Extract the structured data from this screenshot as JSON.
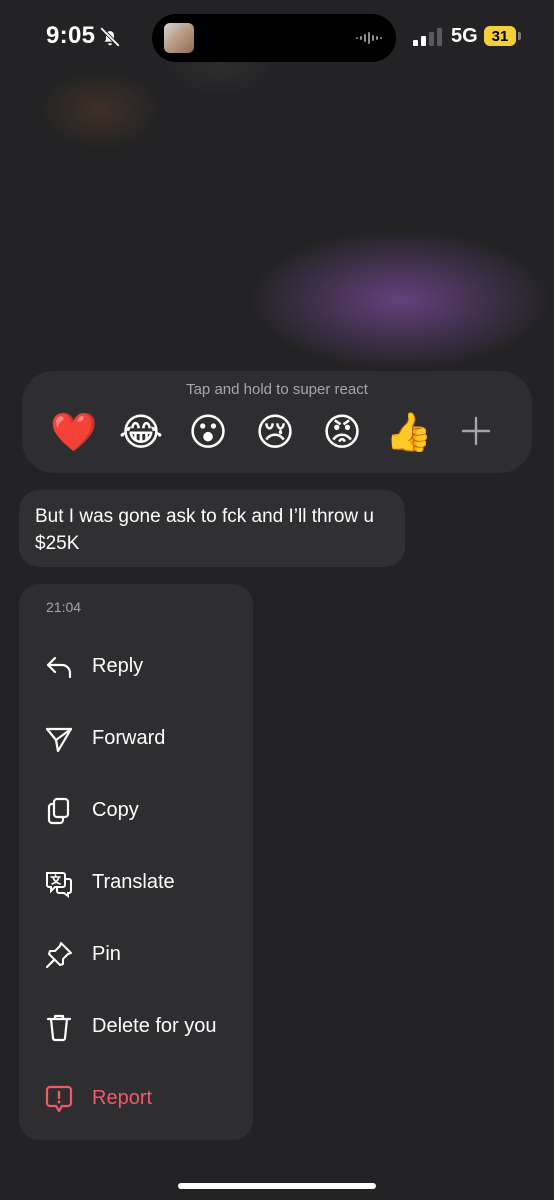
{
  "status_bar": {
    "time": "9:05",
    "network": "5G",
    "battery": "31",
    "icons": [
      "bell-off-icon",
      "signal-icon",
      "battery-icon",
      "audio-wave-icon"
    ]
  },
  "reactions": {
    "hint": "Tap and hold to super react",
    "items": [
      {
        "name": "heart",
        "emoji": "❤️"
      },
      {
        "name": "laughing",
        "emoji": "😂"
      },
      {
        "name": "surprised",
        "emoji": "😮"
      },
      {
        "name": "crying",
        "emoji": "😢"
      },
      {
        "name": "angry",
        "emoji": "😡"
      },
      {
        "name": "thumbs-up",
        "emoji": "👍"
      }
    ],
    "more_icon": "plus-icon"
  },
  "message": {
    "text": "But I was gone ask to fck and I’ll throw u $25K"
  },
  "context_menu": {
    "timestamp": "21:04",
    "items": [
      {
        "label": "Reply",
        "icon": "reply-icon"
      },
      {
        "label": "Forward",
        "icon": "forward-icon"
      },
      {
        "label": "Copy",
        "icon": "copy-icon"
      },
      {
        "label": "Translate",
        "icon": "translate-icon"
      },
      {
        "label": "Pin",
        "icon": "pin-icon"
      },
      {
        "label": "Delete for you",
        "icon": "trash-icon"
      },
      {
        "label": "Report",
        "icon": "report-icon"
      }
    ]
  },
  "colors": {
    "background": "#232325",
    "surface": "#2e2e31",
    "bubble": "#303033",
    "danger": "#f0596a",
    "battery": "#f5cf3a"
  }
}
